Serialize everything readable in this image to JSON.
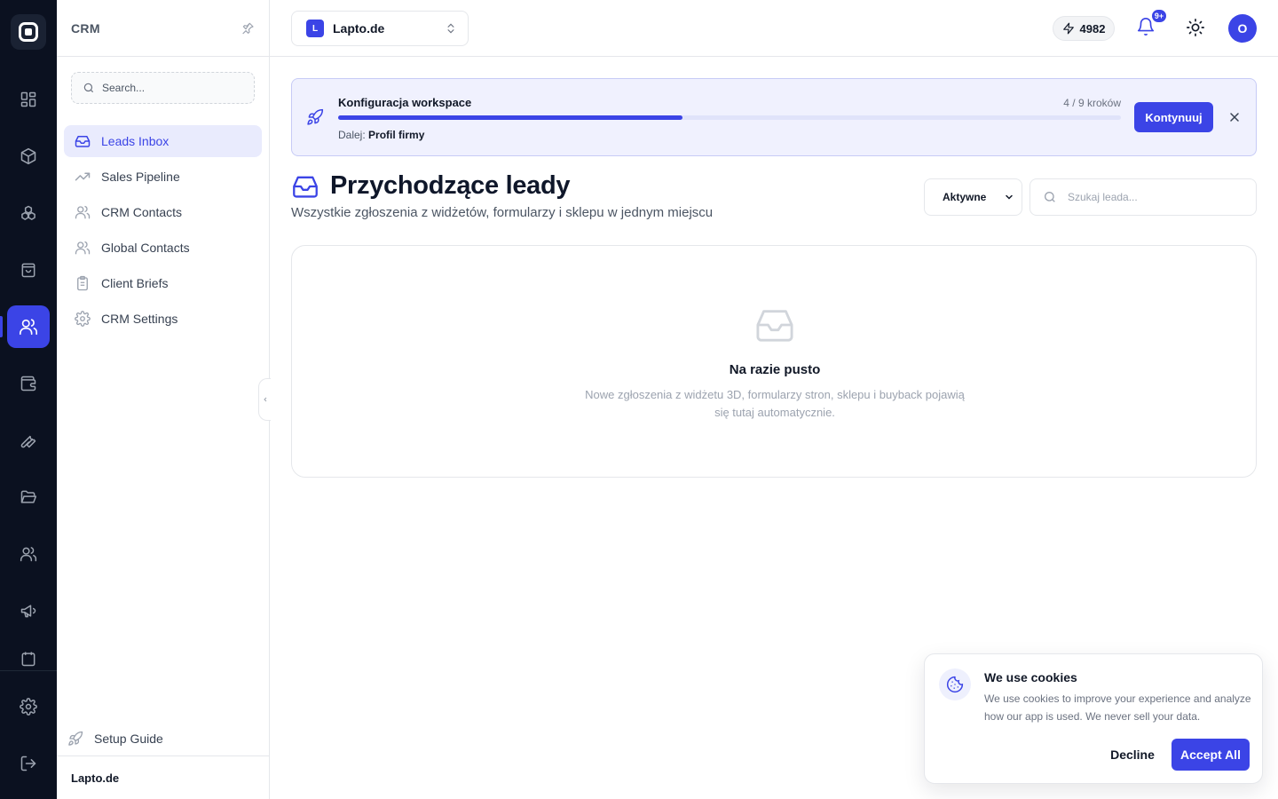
{
  "rail": {
    "items": [
      {
        "icon": "dashboard-icon"
      },
      {
        "icon": "box-icon"
      },
      {
        "icon": "boxes-icon"
      },
      {
        "icon": "shopping-bag-icon"
      },
      {
        "icon": "users-icon",
        "active": true
      },
      {
        "icon": "wallet-icon"
      },
      {
        "icon": "wrench-icon"
      },
      {
        "icon": "folder-open-icon"
      },
      {
        "icon": "team-icon"
      },
      {
        "icon": "megaphone-icon"
      },
      {
        "icon": "settings-icon"
      },
      {
        "icon": "logout-icon"
      }
    ]
  },
  "sidebar": {
    "title": "CRM",
    "search_placeholder": "Search...",
    "items": [
      {
        "label": "Leads Inbox",
        "icon": "inbox-icon",
        "active": true
      },
      {
        "label": "Sales Pipeline",
        "icon": "trending-up-icon"
      },
      {
        "label": "CRM Contacts",
        "icon": "users-icon"
      },
      {
        "label": "Global Contacts",
        "icon": "users-icon"
      },
      {
        "label": "Client Briefs",
        "icon": "clipboard-icon"
      },
      {
        "label": "CRM Settings",
        "icon": "gear-icon"
      }
    ],
    "setup_guide": "Setup Guide",
    "workspace_footer": "Lapto.de"
  },
  "topbar": {
    "workspace_badge": "L",
    "workspace_name": "Lapto.de",
    "credits": "4982",
    "notifications_badge": "9+",
    "avatar_initial": "O"
  },
  "banner": {
    "title": "Konfiguracja workspace",
    "steps_text": "4 / 9 kroków",
    "progress": 0.44,
    "next_label": "Dalej:",
    "next_value": "Profil firmy",
    "cta": "Kontynuuj"
  },
  "page": {
    "title": "Przychodzące leady",
    "subtitle": "Wszystkie zgłoszenia z widżetów, formularzy i sklepu w jednym miejscu",
    "filter_value": "Aktywne",
    "search_placeholder": "Szukaj leada..."
  },
  "empty_state": {
    "title": "Na razie pusto",
    "text": "Nowe zgłoszenia z widżetu 3D, formularzy stron, sklepu i buyback pojawią się tutaj automatycznie."
  },
  "cookie": {
    "title": "We use cookies",
    "text": "We use cookies to improve your experience and analyze how our app is used. We never sell your data.",
    "decline": "Decline",
    "accept": "Accept All"
  },
  "colors": {
    "accent": "#3b44e6",
    "rail_bg": "#0b1120",
    "banner_bg": "#f0f1fe"
  }
}
